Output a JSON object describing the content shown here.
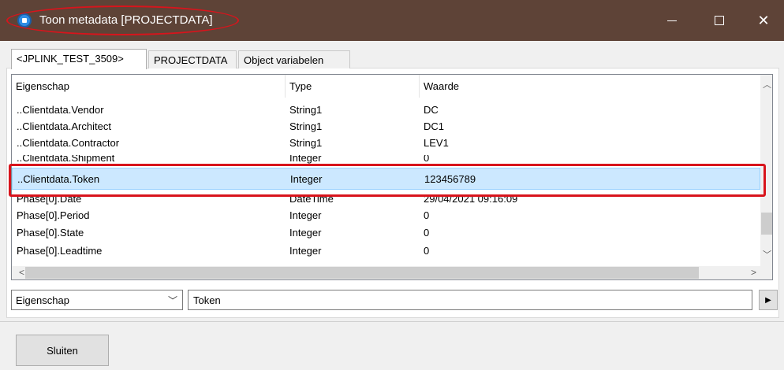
{
  "window": {
    "title": "Toon metadata [PROJECTDATA]",
    "close_glyph": "✕"
  },
  "tabs": [
    {
      "label": "<JPLINK_TEST_3509>",
      "active": true
    },
    {
      "label": "PROJECTDATA",
      "active": false
    },
    {
      "label": "Object variabelen",
      "active": false
    }
  ],
  "table": {
    "columns": [
      "Eigenschap",
      "Type",
      "Waarde"
    ],
    "rows": [
      {
        "property": "..Clientdata.Vendor",
        "type": "String1",
        "value": "DC"
      },
      {
        "property": "..Clientdata.Architect",
        "type": "String1",
        "value": "DC1"
      },
      {
        "property": "..Clientdata.Contractor",
        "type": "String1",
        "value": "LEV1"
      },
      {
        "property": "..Clientdata.Shipment",
        "type": "Integer",
        "value": "0"
      },
      {
        "property": "..Clientdata.Token",
        "type": "Integer",
        "value": "123456789",
        "selected": true
      },
      {
        "property": "Phase[0].Date",
        "type": "DateTime",
        "value": "29/04/2021 09:16:09"
      },
      {
        "property": "Phase[0].Period",
        "type": "Integer",
        "value": "0"
      },
      {
        "property": "Phase[0].State",
        "type": "Integer",
        "value": "0"
      },
      {
        "property": "Phase[0].Leadtime",
        "type": "Integer",
        "value": "0"
      }
    ]
  },
  "filter": {
    "field": "Eigenschap",
    "value": "Token",
    "go_glyph": "▶"
  },
  "footer": {
    "close_label": "Sluiten"
  },
  "colors": {
    "titlebar": "#5e4337",
    "annotation": "#d8141c",
    "selection": "#cce8ff"
  }
}
